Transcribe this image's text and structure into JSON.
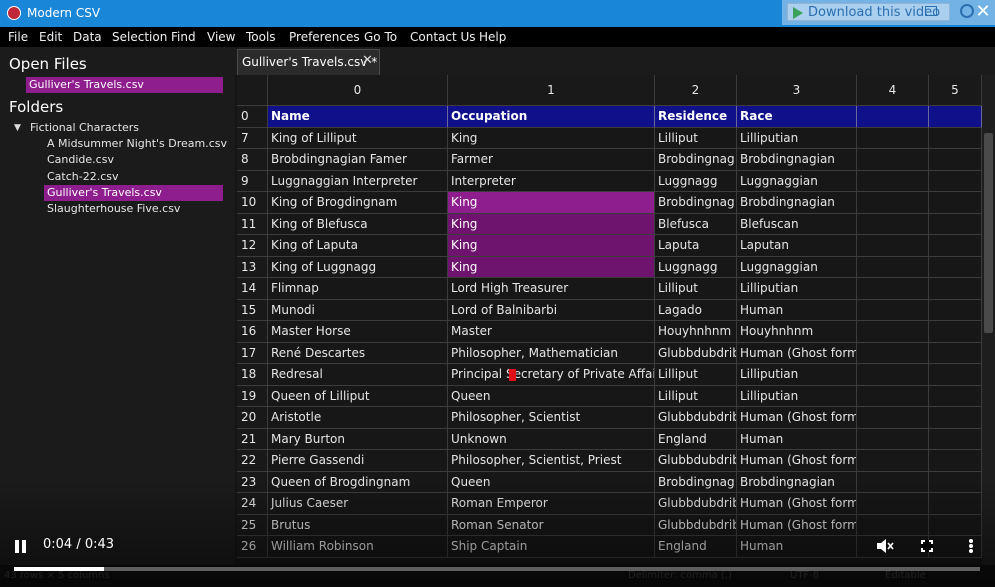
{
  "window": {
    "title": "Modern CSV",
    "close_glyph": "✕"
  },
  "video_overlay": {
    "download_label": "Download this video"
  },
  "menu": [
    "File",
    "Edit",
    "Data",
    "Selection",
    "Find",
    "View",
    "Tools",
    "Preferences",
    "Go To",
    "Contact Us",
    "Help"
  ],
  "sidebar": {
    "open_files_heading": "Open Files",
    "open_files": [
      "Gulliver's Travels.csv"
    ],
    "folders_heading": "Folders",
    "folder_name": "Fictional Characters",
    "folder_arrow": "▼",
    "folder_files": [
      "A Midsummer Night's Dream.csv",
      "Candide.csv",
      "Catch-22.csv",
      "Gulliver's Travels.csv",
      "Slaughterhouse Five.csv"
    ],
    "selected_file_index": 3
  },
  "tab": {
    "label": "Gulliver's Travels.csv *",
    "close_glyph": "✕"
  },
  "grid": {
    "column_indices": [
      "0",
      "1",
      "2",
      "3",
      "4",
      "5"
    ],
    "header_row": {
      "index": "0",
      "cells": [
        "Name",
        "Occupation",
        "Residence",
        "Race",
        "",
        ""
      ]
    },
    "rows": [
      {
        "index": "7",
        "cells": [
          "King of Lilliput",
          "King",
          "Lilliput",
          "Lilliputian"
        ]
      },
      {
        "index": "8",
        "cells": [
          "Brobdingnagian Famer",
          "Farmer",
          "Brobdingnag",
          "Brobdingnagian"
        ]
      },
      {
        "index": "9",
        "cells": [
          "Luggnaggian Interpreter",
          "Interpreter",
          "Luggnagg",
          "Luggnaggian"
        ]
      },
      {
        "index": "10",
        "cells": [
          "King of Brogdingnam",
          "King",
          "Brobdingnag",
          "Brobdingnagian"
        ]
      },
      {
        "index": "11",
        "cells": [
          "King of Blefusca",
          "King",
          "Blefusca",
          "Blefuscan"
        ]
      },
      {
        "index": "12",
        "cells": [
          "King of Laputa",
          "King",
          "Laputa",
          "Laputan"
        ]
      },
      {
        "index": "13",
        "cells": [
          "King of Luggnagg",
          "King",
          "Luggnagg",
          "Luggnaggian"
        ]
      },
      {
        "index": "14",
        "cells": [
          "Flimnap",
          "Lord High Treasurer",
          "Lilliput",
          "Lilliputian"
        ]
      },
      {
        "index": "15",
        "cells": [
          "Munodi",
          "Lord of Balnibarbi",
          "Lagado",
          "Human"
        ]
      },
      {
        "index": "16",
        "cells": [
          "Master Horse",
          "Master",
          "Houyhnhnm",
          "Houyhnhnm"
        ]
      },
      {
        "index": "17",
        "cells": [
          "René Descartes",
          "Philosopher, Mathematician",
          "Glubbdubdrib",
          "Human (Ghost form)"
        ]
      },
      {
        "index": "18",
        "cells": [
          "Redresal",
          "Principal Secretary of Private Affairs",
          "Lilliput",
          "Lilliputian"
        ]
      },
      {
        "index": "19",
        "cells": [
          "Queen of Lilliput",
          "Queen",
          "Lilliput",
          "Lilliputian"
        ]
      },
      {
        "index": "20",
        "cells": [
          "Aristotle",
          "Philosopher, Scientist",
          "Glubbdubdrib",
          "Human (Ghost form)"
        ]
      },
      {
        "index": "21",
        "cells": [
          "Mary Burton",
          "Unknown",
          "England",
          "Human"
        ]
      },
      {
        "index": "22",
        "cells": [
          "Pierre Gassendi",
          "Philosopher, Scientist, Priest",
          "Glubbdubdrib",
          "Human (Ghost form)"
        ]
      },
      {
        "index": "23",
        "cells": [
          "Queen of Brogdingnam",
          "Queen",
          "Brobdingnag",
          "Brobdingnagian"
        ]
      },
      {
        "index": "24",
        "cells": [
          "Julius Caeser",
          "Roman Emperor",
          "Glubbdubdrib",
          "Human (Ghost form)"
        ]
      },
      {
        "index": "25",
        "cells": [
          "Brutus",
          "Roman Senator",
          "Glubbdubdrib",
          "Human (Ghost form)"
        ]
      },
      {
        "index": "26",
        "cells": [
          "William Robinson",
          "Ship Captain",
          "England",
          "Human"
        ]
      }
    ],
    "selected_cells": [
      {
        "row": "10",
        "col": 1,
        "current": true
      },
      {
        "row": "11",
        "col": 1
      },
      {
        "row": "12",
        "col": 1
      },
      {
        "row": "13",
        "col": 1
      }
    ]
  },
  "status": {
    "dimensions": "43 rows × 5 columns",
    "delimiter": "Delimiter: comma (,)",
    "encoding": "UTF-8",
    "mode": "Editable"
  },
  "video": {
    "time": "0:04 / 0:43",
    "progress_fraction": 0.093
  },
  "icons": [
    "app-icon",
    "play-triangle-icon",
    "maximize-icon",
    "gear-icon",
    "close-icon",
    "tab-close-icon",
    "folder-arrow-icon",
    "pause-icon",
    "mute-icon",
    "fullscreen-icon",
    "kebab-menu-icon"
  ],
  "colors": {
    "titlebar": "#1a86d8",
    "selection": "#8e1d8e",
    "header_row": "#10108a",
    "background": "#141414"
  }
}
